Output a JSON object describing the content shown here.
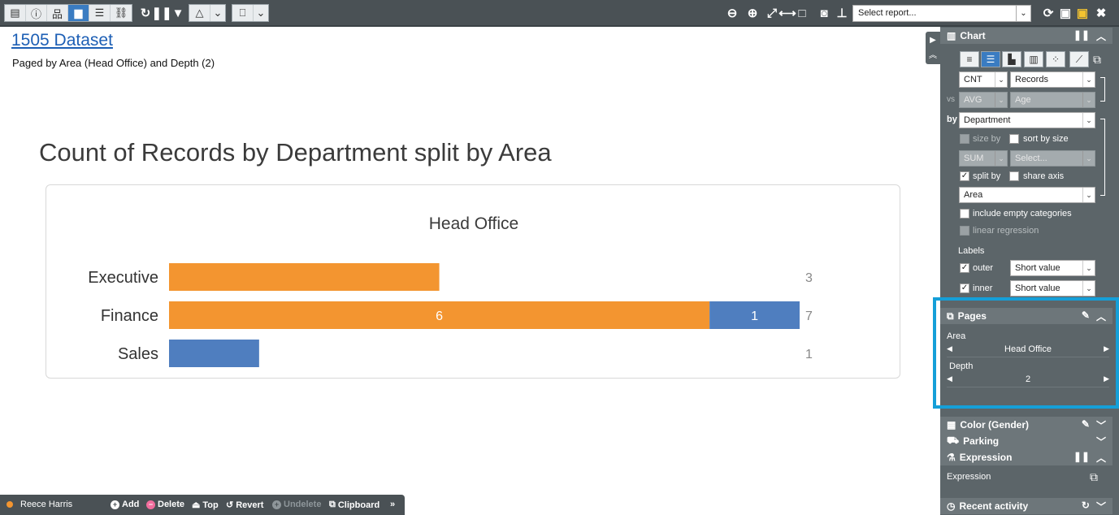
{
  "toolbar": {
    "left_group_1_icons": [
      "table-icon",
      "info-icon",
      "hierarchy-icon",
      "bar-chart-icon",
      "list-icon",
      "link-icon"
    ],
    "report_select_placeholder": "Select report..."
  },
  "main": {
    "dataset_link": "1505 Dataset",
    "paged_by": "Paged by Area (Head Office) and Depth (2)",
    "chart_title": "Count of Records by Department split by Area"
  },
  "chart_data": {
    "type": "bar",
    "orientation": "horizontal",
    "stacked": true,
    "title": "Count of Records by Department split by Area",
    "subtitle": "Head Office",
    "categories": [
      "Executive",
      "Finance",
      "Sales"
    ],
    "series": [
      {
        "values": [
          3,
          6,
          0
        ],
        "color": "#f39530"
      },
      {
        "values": [
          0,
          1,
          1
        ],
        "color": "#4f7ebf"
      }
    ],
    "totals": [
      3,
      7,
      1
    ],
    "inner_labels": [
      null,
      [
        "6",
        "1"
      ],
      null
    ]
  },
  "sidebar": {
    "chart_section": {
      "title": "Chart",
      "measure_func": "CNT",
      "measure_field": "Records",
      "vs_label": "vs",
      "vs_func": "AVG",
      "vs_field": "Age",
      "by_label": "by",
      "by_field": "Department",
      "size_by_label": "size by",
      "sort_by_size_label": "sort by size",
      "size_func": "SUM",
      "size_field": "Select...",
      "split_by_label": "split by",
      "share_axis_label": "share axis",
      "split_field": "Area",
      "include_empty_label": "include empty categories",
      "linear_regression_label": "linear regression",
      "labels_heading": "Labels",
      "outer_label": "outer",
      "outer_value": "Short value",
      "inner_label": "inner",
      "inner_value": "Short value"
    },
    "pages_section": {
      "title": "Pages",
      "area_label": "Area",
      "area_value": "Head Office",
      "depth_label": "Depth",
      "depth_value": "2"
    },
    "color_section": {
      "title": "Color (Gender)"
    },
    "parking_section": {
      "title": "Parking"
    },
    "expression_section": {
      "title": "Expression",
      "body_label": "Expression"
    },
    "recent_section": {
      "title": "Recent activity"
    }
  },
  "bottom_bar": {
    "user": "Reece Harris",
    "add": "Add",
    "delete": "Delete",
    "top": "Top",
    "revert": "Revert",
    "undelete": "Undelete",
    "clipboard": "Clipboard",
    "more": "»"
  }
}
